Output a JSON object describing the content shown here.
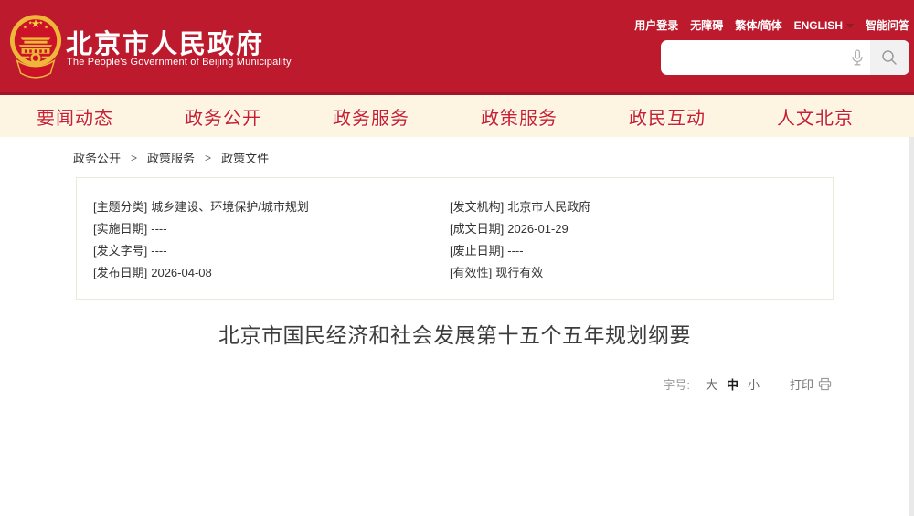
{
  "header": {
    "site_title": "北京市人民政府",
    "site_subtitle": "The People's Government of Beijing Municipality",
    "top_links": {
      "login": "用户登录",
      "accessibility": "无障碍",
      "traditional_simplified": "繁体/简体",
      "english": "ENGLISH",
      "smart_qa": "智能问答"
    }
  },
  "search": {
    "value": ""
  },
  "nav": {
    "items": [
      "要闻动态",
      "政务公开",
      "政务服务",
      "政策服务",
      "政民互动",
      "人文北京"
    ]
  },
  "breadcrumb": {
    "items": [
      "政务公开",
      "政策服务",
      "政策文件"
    ],
    "separator": ">"
  },
  "doc_meta": {
    "left": [
      {
        "label": "[主题分类]",
        "value": "城乡建设、环境保护/城市规划"
      },
      {
        "label": "[实施日期]",
        "value": "----"
      },
      {
        "label": "[发文字号]",
        "value": "----"
      },
      {
        "label": "[发布日期]",
        "value": "2026-04-08"
      }
    ],
    "right": [
      {
        "label": "[发文机构]",
        "value": "北京市人民政府"
      },
      {
        "label": "[成文日期]",
        "value": "2026-01-29"
      },
      {
        "label": "[废止日期]",
        "value": "----"
      },
      {
        "label": "[有效性]",
        "value": "现行有效"
      }
    ]
  },
  "article": {
    "title": "北京市国民经济和社会发展第十五个五年规划纲要"
  },
  "toolbar": {
    "font_size_label": "字号:",
    "size_large": "大",
    "size_medium": "中",
    "size_small": "小",
    "active_size": "中",
    "print_label": "打印"
  },
  "colors": {
    "header_red": "#bd1a2d",
    "header_border_red": "#a21426",
    "nav_background": "#fdf5e2",
    "nav_text_red": "#c8202f",
    "emblem_gold": "#efb73a",
    "text_dark": "#333333"
  }
}
